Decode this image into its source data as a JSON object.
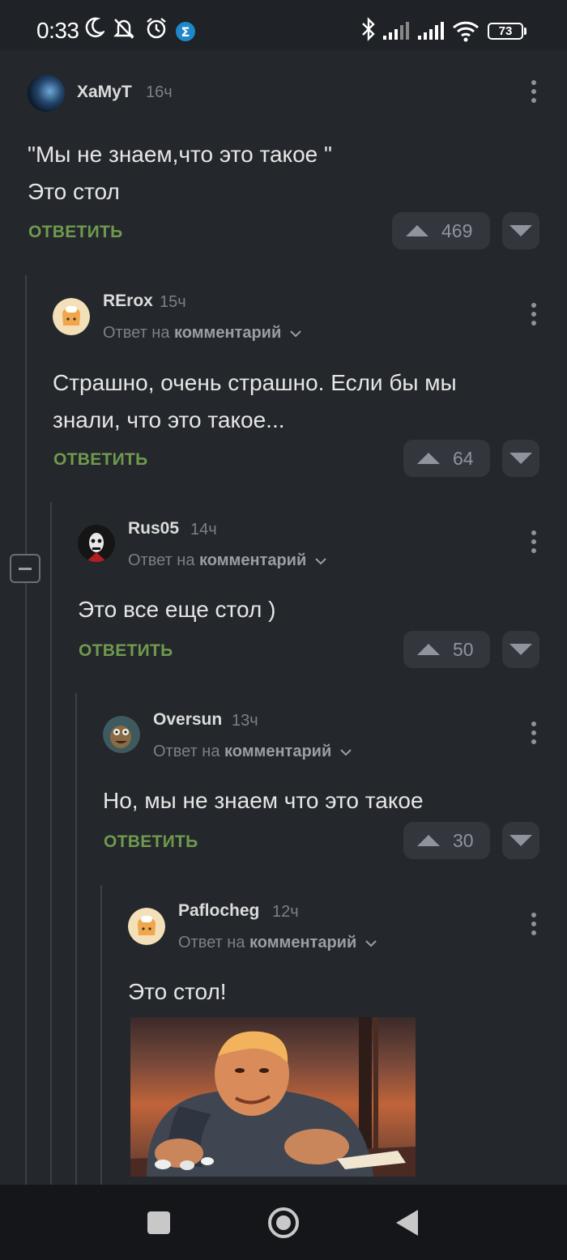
{
  "status_bar": {
    "time": "0:33",
    "battery": "73",
    "icons": [
      "moon-icon",
      "bell-muted-icon",
      "alarm-icon",
      "app-badge-icon",
      "bluetooth-icon",
      "signal-icon",
      "signal-icon",
      "wifi-icon",
      "battery-icon"
    ]
  },
  "ui": {
    "reply_to_prefix": "Ответ на",
    "reply_to_target": "комментарий",
    "answer_label": "ОТВЕТИТЬ"
  },
  "comments": [
    {
      "user": "ХаМуТ",
      "time": "16ч",
      "text_lines": [
        "\"Мы не знаем,что это такое \"",
        "Это стол"
      ],
      "votes": "469"
    },
    {
      "user": "RErox",
      "time": "15ч",
      "text_lines": [
        "Страшно, очень страшно. Если бы мы",
        "знали, что это такое..."
      ],
      "votes": "64"
    },
    {
      "user": "Rus05",
      "time": "14ч",
      "text_lines": [
        "Это все еще стол )"
      ],
      "votes": "50"
    },
    {
      "user": "Oversun",
      "time": "13ч",
      "text_lines": [
        "Но, мы не знаем что это такое"
      ],
      "votes": "30"
    },
    {
      "user": "Paflocheg",
      "time": "12ч",
      "text_lines": [
        "Это стол!"
      ]
    }
  ],
  "colors": {
    "background": "#24272c",
    "answer_green": "#6f9a4d",
    "vote_bg": "#33373d"
  }
}
